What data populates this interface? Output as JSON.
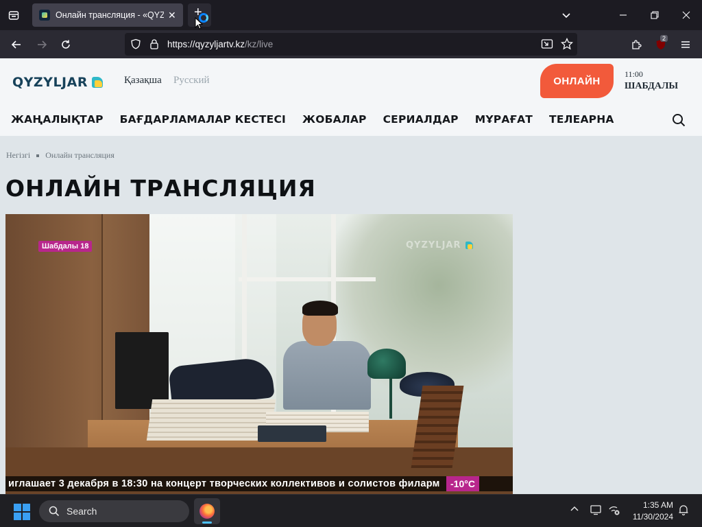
{
  "browser": {
    "tab_title": "Онлайн трансляция - «QYZYL",
    "tab_close": "✕",
    "new_tab": "+",
    "url_host": "https://qyzyljartv.kz",
    "url_path": "/kz/live",
    "extensions_badge": "2"
  },
  "site": {
    "logo": "QYZYLJAR",
    "lang_kz": "Қазақша",
    "lang_ru": "Русский",
    "online_button": "ОНЛАЙН",
    "schedule_time": "11:00",
    "schedule_name": "ШАБДАЛЫ",
    "menu": [
      {
        "label": "ЖАҢАЛЫҚТАР"
      },
      {
        "label": "БАҒДАРЛАМАЛАР КЕСТЕСІ"
      },
      {
        "label": "ЖОБАЛАР"
      },
      {
        "label": "СЕРИАЛДАР"
      },
      {
        "label": "МҰРАҒАТ"
      },
      {
        "label": "ТЕЛЕАРНА"
      }
    ]
  },
  "page": {
    "breadcrumb_home": "Негізгі",
    "breadcrumb_current": "Онлайн трансляция",
    "title": "ОНЛАЙН ТРАНСЛЯЦИЯ"
  },
  "player": {
    "channel_badge": "Шабдалы 18",
    "watermark": "QYZYLJAR",
    "ticker": "иглашает 3 декабря в 18:30 на концерт творческих коллективов и солистов филарм",
    "temperature": "-10°C"
  },
  "taskbar": {
    "search_label": "Search",
    "time": "1:35 AM",
    "date": "11/30/2024"
  },
  "colors": {
    "accent_online": "#f25a3b",
    "logo_blue": "#17425a",
    "badge_magenta": "#b8268c"
  }
}
